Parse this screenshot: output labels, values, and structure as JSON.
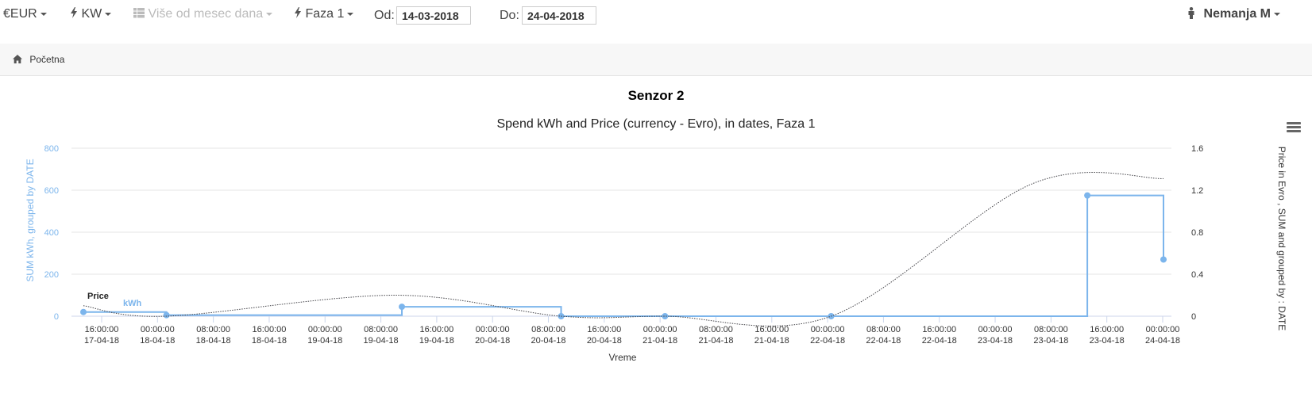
{
  "nav": {
    "currency": {
      "symbol": "€",
      "label": "EUR"
    },
    "unit": {
      "label": "KW"
    },
    "period": {
      "label": "Više od mesec dana"
    },
    "phase": {
      "label": "Faza 1"
    },
    "from": {
      "label": "Od:",
      "value": "14-03-2018"
    },
    "to": {
      "label": "Do:",
      "value": "24-04-2018"
    },
    "user": {
      "name": "Nemanja M"
    }
  },
  "breadcrumb": {
    "home": "Početna"
  },
  "colors": {
    "kwh": "#7cb5ec",
    "price": "#434348",
    "grid": "#e6e6e6"
  },
  "chart_data": {
    "type": "line",
    "title": "Senzor 2",
    "subtitle": "Spend kWh and Price (currency - Evro), in dates, Faza 1",
    "xlabel": "Vreme",
    "ylabel": "SUM kWh, grouped by DATE",
    "y2label": "Price in Evro , SUM and grouped by : DATE",
    "ylim": [
      0,
      800
    ],
    "y2lim": [
      0,
      1.6
    ],
    "yticks": [
      0,
      200,
      400,
      600,
      800
    ],
    "y2ticks": [
      "0",
      "0.4",
      "0.8",
      "1.2",
      "1.6"
    ],
    "grid": true,
    "xticks": [
      [
        "16:00:00",
        "17-04-18"
      ],
      [
        "00:00:00",
        "18-04-18"
      ],
      [
        "08:00:00",
        "18-04-18"
      ],
      [
        "16:00:00",
        "18-04-18"
      ],
      [
        "00:00:00",
        "19-04-18"
      ],
      [
        "08:00:00",
        "19-04-18"
      ],
      [
        "16:00:00",
        "19-04-18"
      ],
      [
        "00:00:00",
        "20-04-18"
      ],
      [
        "08:00:00",
        "20-04-18"
      ],
      [
        "16:00:00",
        "20-04-18"
      ],
      [
        "00:00:00",
        "21-04-18"
      ],
      [
        "08:00:00",
        "21-04-18"
      ],
      [
        "16:00:00",
        "21-04-18"
      ],
      [
        "00:00:00",
        "22-04-18"
      ],
      [
        "08:00:00",
        "22-04-18"
      ],
      [
        "16:00:00",
        "22-04-18"
      ],
      [
        "00:00:00",
        "23-04-18"
      ],
      [
        "08:00:00",
        "23-04-18"
      ],
      [
        "16:00:00",
        "23-04-18"
      ],
      [
        "00:00:00",
        "24-04-18"
      ]
    ],
    "series": [
      {
        "name": "kWh",
        "axis": "left",
        "step": true,
        "points": [
          {
            "x": "2018-04-17 12:00",
            "y": 20
          },
          {
            "x": "2018-04-18 00:00",
            "y": 5
          },
          {
            "x": "2018-04-19 10:00",
            "y": 45
          },
          {
            "x": "2018-04-20 09:00",
            "y": 0
          },
          {
            "x": "2018-04-21 00:00",
            "y": 0
          },
          {
            "x": "2018-04-22 00:00",
            "y": 0
          },
          {
            "x": "2018-04-23 13:00",
            "y": 575
          },
          {
            "x": "2018-04-24 00:00",
            "y": 270
          }
        ],
        "dots": [
          {
            "x": "2018-04-17 12:00",
            "y": 20
          },
          {
            "x": "2018-04-18 00:00",
            "y": 5
          },
          {
            "x": "2018-04-19 10:00",
            "y": 45
          },
          {
            "x": "2018-04-20 09:00",
            "y": 0
          },
          {
            "x": "2018-04-21 00:00",
            "y": 0
          },
          {
            "x": "2018-04-22 00:00",
            "y": 0
          },
          {
            "x": "2018-04-23 13:00",
            "y": 575
          },
          {
            "x": "2018-04-24 00:00",
            "y": 270
          }
        ]
      },
      {
        "name": "Price",
        "axis": "right",
        "smooth": true,
        "points": [
          {
            "x": "2018-04-17 12:00",
            "y": 0.1
          },
          {
            "x": "2018-04-18 00:00",
            "y": 0.0
          },
          {
            "x": "2018-04-19 09:00",
            "y": 0.2
          },
          {
            "x": "2018-04-20 09:00",
            "y": 0.0
          },
          {
            "x": "2018-04-21 00:00",
            "y": 0.0
          },
          {
            "x": "2018-04-22 00:00",
            "y": 0.0
          },
          {
            "x": "2018-04-23 05:00",
            "y": 1.26
          },
          {
            "x": "2018-04-24 00:00",
            "y": 1.31
          }
        ]
      }
    ]
  }
}
